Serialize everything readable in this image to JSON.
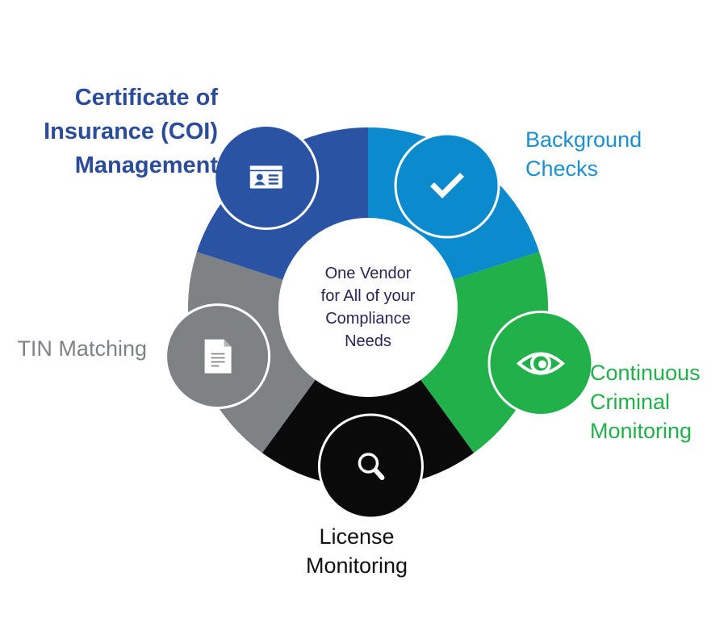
{
  "center": {
    "lines": [
      "One Vendor",
      "for All of your",
      "Compliance",
      "Needs"
    ],
    "color": "#2a2557"
  },
  "segments": [
    {
      "id": "background-checks",
      "label_lines": [
        "Background",
        "Checks"
      ],
      "color": "#0b8bcd",
      "icon": "checkmark-icon"
    },
    {
      "id": "continuous-criminal-monitoring",
      "label_lines": [
        "Continuous",
        "Criminal",
        "Monitoring"
      ],
      "color": "#22b04b",
      "icon": "eye-icon"
    },
    {
      "id": "license-monitoring",
      "label_lines": [
        "License",
        "Monitoring"
      ],
      "color": "#0a0a0a",
      "icon": "magnifier-icon"
    },
    {
      "id": "tin-matching",
      "label_lines": [
        "TIN Matching"
      ],
      "color": "#7e8284",
      "icon": "document-icon"
    },
    {
      "id": "coi-management",
      "label_lines": [
        "Certificate of",
        "Insurance (COI)",
        "Management"
      ],
      "color": "#2b53a3",
      "icon": "id-card-icon"
    }
  ],
  "label_colors": {
    "coi": "#2b4c9b",
    "background": "#1b8fcf",
    "ccm": "#22b04b",
    "license": "#111111",
    "tin": "#7e8284"
  }
}
